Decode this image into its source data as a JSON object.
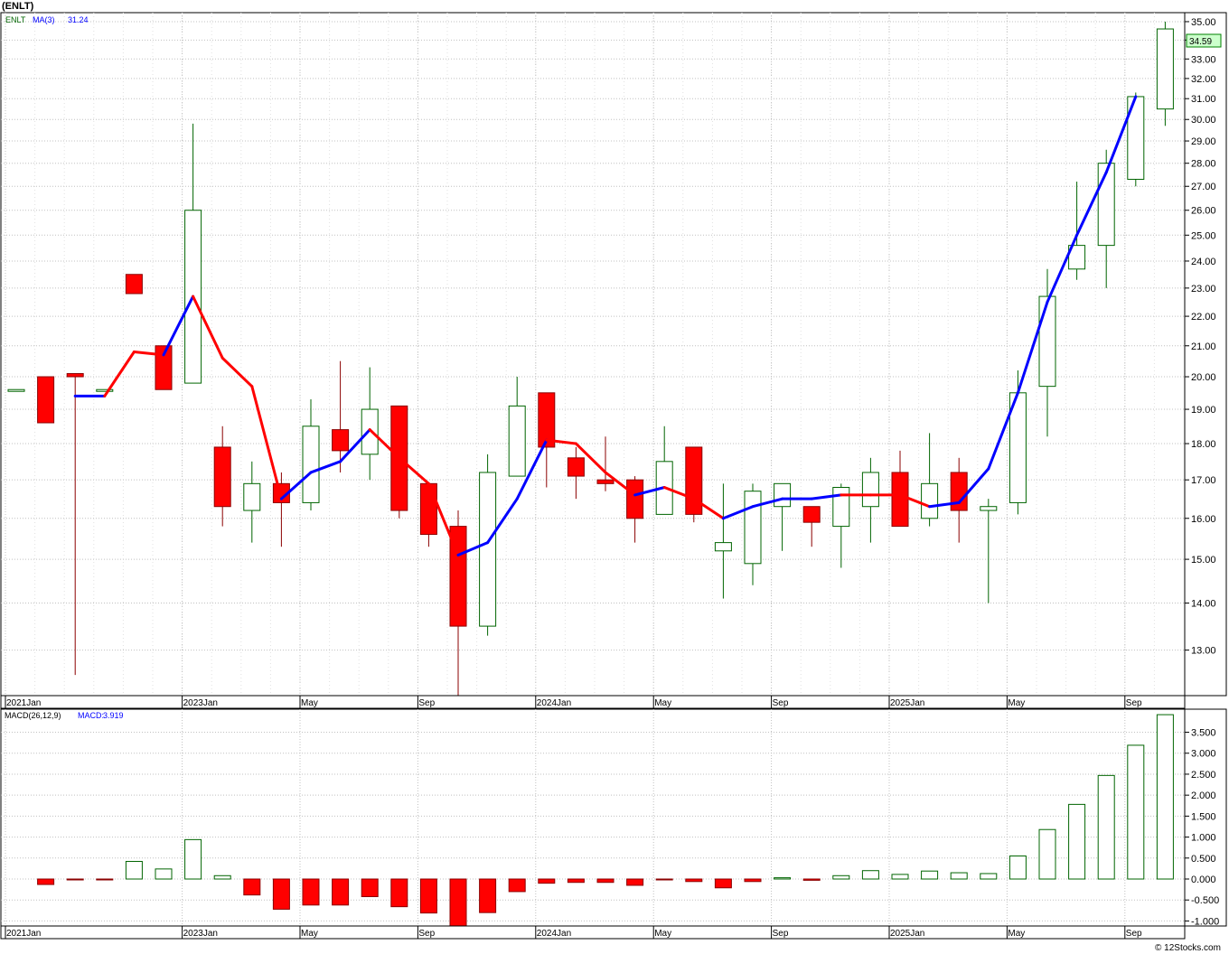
{
  "ticker_title": "(ENLT)",
  "watermark": "© 12Stocks.com",
  "chart_data": [
    {
      "type": "candlestick",
      "panel": "price",
      "legend": {
        "symbol": "ENLT",
        "indicator": "MA(3)",
        "indicator_value": "31.24"
      },
      "last_price_label": "34.59",
      "x_tick_labels": [
        {
          "label": "2021Jan",
          "month": 0
        },
        {
          "label": "2023Jan",
          "month": 6
        },
        {
          "label": "May",
          "month": 10
        },
        {
          "label": "Sep",
          "month": 14
        },
        {
          "label": "2024Jan",
          "month": 18
        },
        {
          "label": "May",
          "month": 22
        },
        {
          "label": "Sep",
          "month": 26
        },
        {
          "label": "2025Jan",
          "month": 30
        },
        {
          "label": "May",
          "month": 34
        },
        {
          "label": "Sep",
          "month": 38
        }
      ],
      "y_tick_labels": [
        "13.00",
        "14.00",
        "15.00",
        "16.00",
        "17.00",
        "18.00",
        "19.00",
        "20.00",
        "21.00",
        "22.00",
        "23.00",
        "24.00",
        "25.00",
        "26.00",
        "27.00",
        "28.00",
        "29.00",
        "30.00",
        "31.00",
        "32.00",
        "33.00",
        "34.00",
        "35.00"
      ],
      "y_scale": "log",
      "ylim": [
        12.1,
        35.5
      ],
      "candles": [
        {
          "o": 19.6,
          "h": 19.6,
          "l": 19.6,
          "c": 19.6
        },
        {
          "o": 20.0,
          "h": 20.0,
          "l": 18.6,
          "c": 18.6
        },
        {
          "o": 20.1,
          "h": 20.1,
          "l": 12.5,
          "c": 20.0
        },
        {
          "o": 19.6,
          "h": 19.6,
          "l": 19.6,
          "c": 19.6
        },
        {
          "o": 23.5,
          "h": 23.5,
          "l": 22.8,
          "c": 22.8
        },
        {
          "o": 21.0,
          "h": 21.0,
          "l": 19.6,
          "c": 19.6
        },
        {
          "o": 19.8,
          "h": 29.8,
          "l": 19.8,
          "c": 26.0
        },
        {
          "o": 17.9,
          "h": 18.5,
          "l": 15.8,
          "c": 16.3
        },
        {
          "o": 16.2,
          "h": 17.5,
          "l": 15.4,
          "c": 16.9
        },
        {
          "o": 16.9,
          "h": 17.2,
          "l": 15.3,
          "c": 16.4
        },
        {
          "o": 16.4,
          "h": 19.3,
          "l": 16.2,
          "c": 18.5
        },
        {
          "o": 18.4,
          "h": 20.5,
          "l": 17.2,
          "c": 17.8
        },
        {
          "o": 17.7,
          "h": 20.3,
          "l": 17.0,
          "c": 19.0
        },
        {
          "o": 19.1,
          "h": 19.1,
          "l": 16.0,
          "c": 16.2
        },
        {
          "o": 16.9,
          "h": 16.9,
          "l": 15.3,
          "c": 15.6
        },
        {
          "o": 15.8,
          "h": 16.2,
          "l": 12.0,
          "c": 13.5
        },
        {
          "o": 13.5,
          "h": 17.7,
          "l": 13.3,
          "c": 17.2
        },
        {
          "o": 17.1,
          "h": 20.0,
          "l": 17.1,
          "c": 19.1
        },
        {
          "o": 19.5,
          "h": 19.5,
          "l": 16.8,
          "c": 17.9
        },
        {
          "o": 17.6,
          "h": 17.9,
          "l": 16.5,
          "c": 17.1
        },
        {
          "o": 17.0,
          "h": 18.2,
          "l": 16.7,
          "c": 16.9
        },
        {
          "o": 17.0,
          "h": 17.1,
          "l": 15.4,
          "c": 16.0
        },
        {
          "o": 16.1,
          "h": 18.5,
          "l": 16.1,
          "c": 17.5
        },
        {
          "o": 17.9,
          "h": 17.9,
          "l": 15.9,
          "c": 16.1
        },
        {
          "o": 15.2,
          "h": 16.9,
          "l": 14.1,
          "c": 15.4
        },
        {
          "o": 14.9,
          "h": 16.9,
          "l": 14.4,
          "c": 16.7
        },
        {
          "o": 16.3,
          "h": 16.9,
          "l": 15.2,
          "c": 16.9
        },
        {
          "o": 16.3,
          "h": 16.3,
          "l": 15.3,
          "c": 15.9
        },
        {
          "o": 15.8,
          "h": 16.9,
          "l": 14.8,
          "c": 16.8
        },
        {
          "o": 16.3,
          "h": 17.6,
          "l": 15.4,
          "c": 17.2
        },
        {
          "o": 17.2,
          "h": 17.8,
          "l": 15.8,
          "c": 15.8
        },
        {
          "o": 16.0,
          "h": 18.3,
          "l": 15.8,
          "c": 16.9
        },
        {
          "o": 17.2,
          "h": 17.6,
          "l": 15.4,
          "c": 16.2
        },
        {
          "o": 16.2,
          "h": 16.5,
          "l": 14.0,
          "c": 16.3
        },
        {
          "o": 16.4,
          "h": 20.2,
          "l": 16.1,
          "c": 19.5
        },
        {
          "o": 19.7,
          "h": 23.7,
          "l": 18.2,
          "c": 22.7
        },
        {
          "o": 23.7,
          "h": 27.2,
          "l": 23.3,
          "c": 24.6
        },
        {
          "o": 24.6,
          "h": 28.6,
          "l": 23.0,
          "c": 28.0
        },
        {
          "o": 27.3,
          "h": 31.3,
          "l": 27.0,
          "c": 31.1
        },
        {
          "o": 30.5,
          "h": 35.0,
          "l": 29.7,
          "c": 34.6
        }
      ],
      "ma3": [
        null,
        19.4,
        19.4,
        20.8,
        20.7,
        22.7,
        20.6,
        19.7,
        16.5,
        17.2,
        17.5,
        18.4,
        17.6,
        16.9,
        15.1,
        15.4,
        16.5,
        18.1,
        18.0,
        17.2,
        16.6,
        16.8,
        16.5,
        16.0,
        16.3,
        16.5,
        16.5,
        16.6,
        16.6,
        16.6,
        16.3,
        16.4,
        17.3,
        19.5,
        22.5,
        25.0,
        27.6,
        31.1
      ],
      "ma3_offset": 1,
      "ma3_colors": [
        "#0000ff",
        "#0000ff",
        "#ff0000",
        "#ff0000",
        "#0000ff",
        "#ff0000",
        "#ff0000",
        "#ff0000",
        "#0000ff",
        "#0000ff",
        "#0000ff",
        "#ff0000",
        "#ff0000",
        "#ff0000",
        "#0000ff",
        "#0000ff",
        "#0000ff",
        "#ff0000",
        "#ff0000",
        "#ff0000",
        "#0000ff",
        "#ff0000",
        "#ff0000",
        "#0000ff",
        "#0000ff",
        "#0000ff",
        "#0000ff",
        "#ff0000",
        "#ff0000",
        "#ff0000",
        "#0000ff",
        "#0000ff",
        "#0000ff",
        "#0000ff",
        "#0000ff",
        "#0000ff",
        "#0000ff"
      ],
      "colors": {
        "up_fill": "#ffffff",
        "up_stroke": "#006400",
        "down_fill": "#ff0000",
        "down_stroke": "#8b0000",
        "ma_up": "#0000ff",
        "ma_down": "#ff0000",
        "price_tag_bg": "#ccffcc"
      }
    },
    {
      "type": "bar",
      "panel": "macd",
      "legend": {
        "indicator": "MACD(26,12,9)",
        "label": "MACD:",
        "value": "3.919"
      },
      "x_tick_labels": [
        {
          "label": "2021Jan",
          "month": 0
        },
        {
          "label": "2023Jan",
          "month": 6
        },
        {
          "label": "May",
          "month": 10
        },
        {
          "label": "Sep",
          "month": 14
        },
        {
          "label": "2024Jan",
          "month": 18
        },
        {
          "label": "May",
          "month": 22
        },
        {
          "label": "Sep",
          "month": 26
        },
        {
          "label": "2025Jan",
          "month": 30
        },
        {
          "label": "May",
          "month": 34
        },
        {
          "label": "Sep",
          "month": 38
        }
      ],
      "y_tick_labels": [
        "-1.000",
        "-0.500",
        "0.000",
        "0.500",
        "1.000",
        "1.500",
        "2.000",
        "2.500",
        "3.000",
        "3.500"
      ],
      "ylim": [
        -1.12,
        4.05
      ],
      "values": [
        0,
        -0.13,
        -0.02,
        -0.01,
        0.42,
        0.24,
        0.94,
        0.08,
        -0.38,
        -0.72,
        -0.62,
        -0.62,
        -0.42,
        -0.66,
        -0.81,
        -1.14,
        -0.8,
        -0.3,
        -0.1,
        -0.08,
        -0.08,
        -0.15,
        -0.01,
        -0.06,
        -0.21,
        -0.06,
        0.03,
        -0.03,
        0.08,
        0.2,
        0.11,
        0.19,
        0.15,
        0.13,
        0.55,
        1.18,
        1.78,
        2.47,
        3.19,
        3.919
      ]
    }
  ]
}
